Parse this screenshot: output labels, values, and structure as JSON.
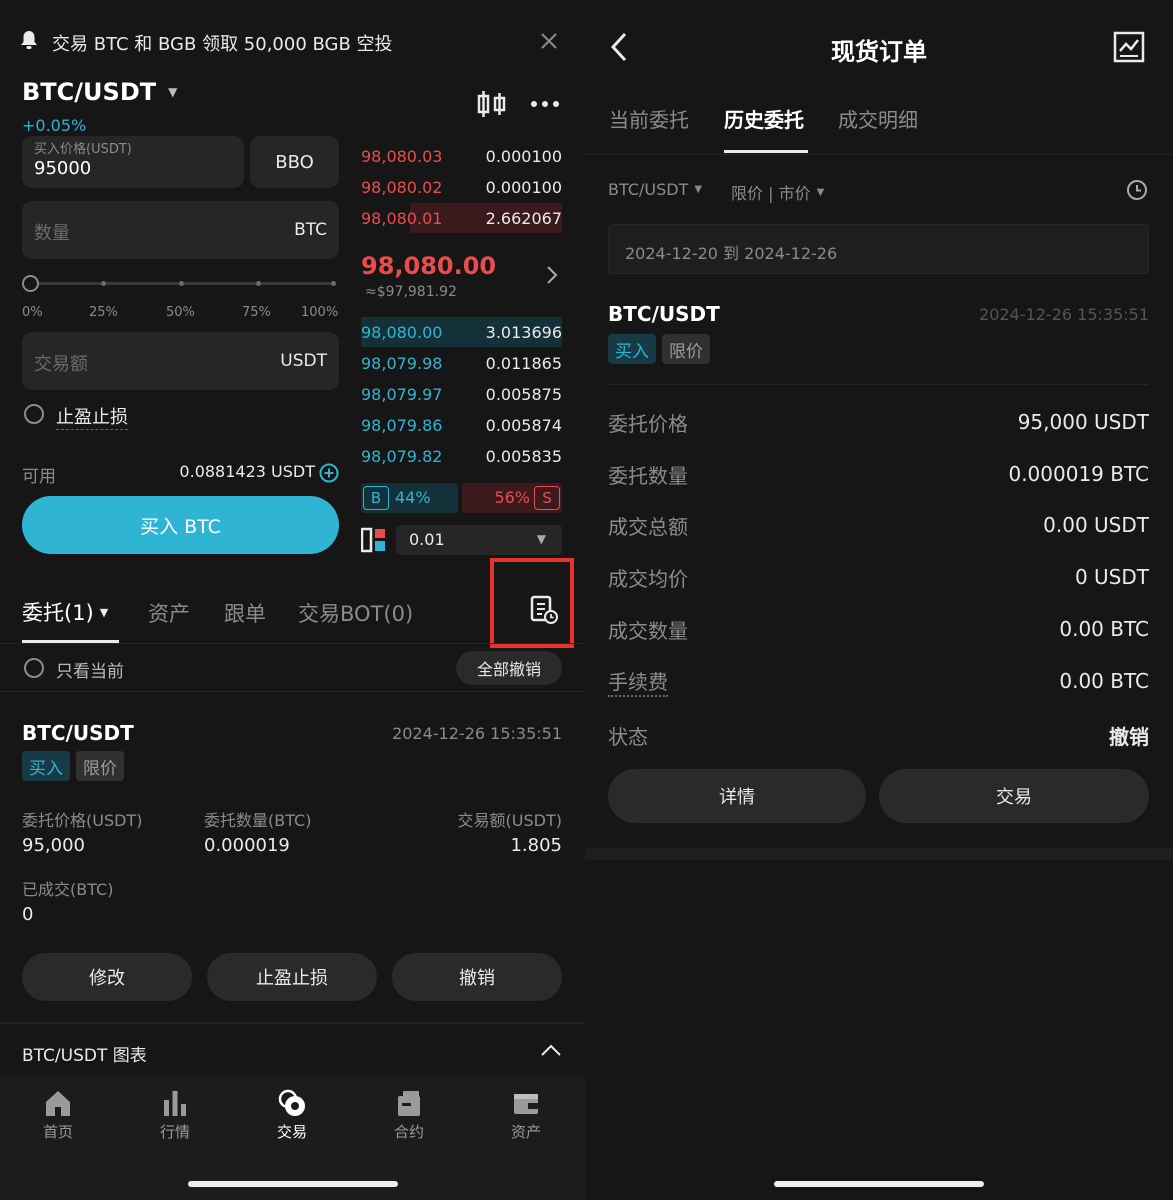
{
  "left": {
    "banner": {
      "text": "交易 BTC 和 BGB 领取 50,000 BGB 空投"
    },
    "header": {
      "pair": "BTC/USDT",
      "change": "+0.05%"
    },
    "form": {
      "price_label": "买入价格(USDT)",
      "price_value": "95000",
      "bbo_label": "BBO",
      "amount_placeholder": "数量",
      "amount_unit": "BTC",
      "slider_ticks": [
        "0%",
        "25%",
        "50%",
        "75%",
        "100%"
      ],
      "slider_value": 0,
      "total_placeholder": "交易额",
      "total_unit": "USDT",
      "tpsl_label": "止盈止损",
      "avail_label": "可用",
      "avail_value": "0.0881423 USDT",
      "buy_label": "买入 BTC"
    },
    "orderbook": {
      "asks": [
        {
          "price": "98,080.03",
          "qty": "0.000100"
        },
        {
          "price": "98,080.02",
          "qty": "0.000100"
        },
        {
          "price": "98,080.01",
          "qty": "2.662067"
        }
      ],
      "last_price": "98,080.00",
      "last_price_usd": "≈$97,981.92",
      "bids": [
        {
          "price": "98,080.00",
          "qty": "3.013696"
        },
        {
          "price": "98,079.98",
          "qty": "0.011865"
        },
        {
          "price": "98,079.97",
          "qty": "0.005875"
        },
        {
          "price": "98,079.86",
          "qty": "0.005874"
        },
        {
          "price": "98,079.82",
          "qty": "0.005835"
        }
      ],
      "buy_ratio_label": "B",
      "buy_ratio": "44%",
      "sell_ratio": "56%",
      "sell_ratio_label": "S",
      "precision": "0.01"
    },
    "tabs": [
      "委托(1)",
      "资产",
      "跟单",
      "交易BOT(0)"
    ],
    "filter": {
      "only_current": "只看当前",
      "cancel_all": "全部撤销"
    },
    "order": {
      "pair": "BTC/USDT",
      "time": "2024-12-26 15:35:51",
      "side": "买入",
      "type": "限价",
      "price_label": "委托价格(USDT)",
      "price_value": "95,000",
      "qty_label": "委托数量(BTC)",
      "qty_value": "0.000019",
      "total_label": "交易额(USDT)",
      "total_value": "1.805",
      "filled_label": "已成交(BTC)",
      "filled_value": "0",
      "btn_modify": "修改",
      "btn_tpsl": "止盈止损",
      "btn_cancel": "撤销"
    },
    "chart_bar": {
      "label": "BTC/USDT 图表"
    },
    "nav": [
      "首页",
      "行情",
      "交易",
      "合约",
      "资产"
    ]
  },
  "right": {
    "title": "现货订单",
    "tabs": [
      "当前委托",
      "历史委托",
      "成交明细"
    ],
    "filter_pair": "BTC/USDT",
    "filter_type": "限价 | 市价",
    "date_range": "2024-12-20 到 2024-12-26",
    "order": {
      "pair": "BTC/USDT",
      "time": "2024-12-26 15:35:51",
      "side": "买入",
      "type": "限价",
      "rows": [
        {
          "k": "委托价格",
          "v": "95,000 USDT"
        },
        {
          "k": "委托数量",
          "v": "0.000019 BTC"
        },
        {
          "k": "成交总额",
          "v": "0.00 USDT"
        },
        {
          "k": "成交均价",
          "v": "0 USDT"
        },
        {
          "k": "成交数量",
          "v": "0.00 BTC"
        },
        {
          "k": "手续费",
          "v": "0.00 BTC"
        },
        {
          "k": "状态",
          "v": "撤销"
        }
      ],
      "btn_details": "详情",
      "btn_trade": "交易"
    }
  }
}
